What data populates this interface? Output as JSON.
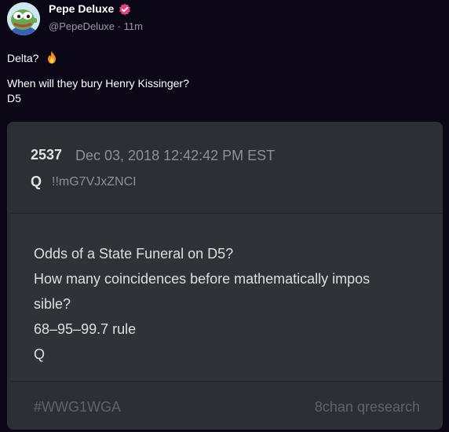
{
  "author": {
    "name": "Pepe Deluxe",
    "verified_badge_icon": "verified-badge-icon",
    "handle": "@PepeDeluxe",
    "separator": " · ",
    "time": "11m"
  },
  "post": {
    "line1": "Delta?",
    "line1_emoji_icon": "fire-icon",
    "line2": "When will they bury Henry Kissinger?",
    "line3": "D5"
  },
  "card": {
    "post_number": "2537",
    "date": "Dec 03, 2018 12:42:42 PM EST",
    "signature": "Q",
    "tripcode": "!!mG7VJxZNCI",
    "body_lines": [
      "Odds of a State Funeral on D5?",
      "How many coincidences before mathematically impos",
      "sible?",
      "68–95–99.7 rule",
      "Q"
    ],
    "hashtag": "#WWG1WGA",
    "source": "8chan qresearch"
  },
  "colors": {
    "background": "#0b0716",
    "card": "#2b2e33",
    "badge": "#e0457b",
    "muted_text": "#8d9096"
  }
}
